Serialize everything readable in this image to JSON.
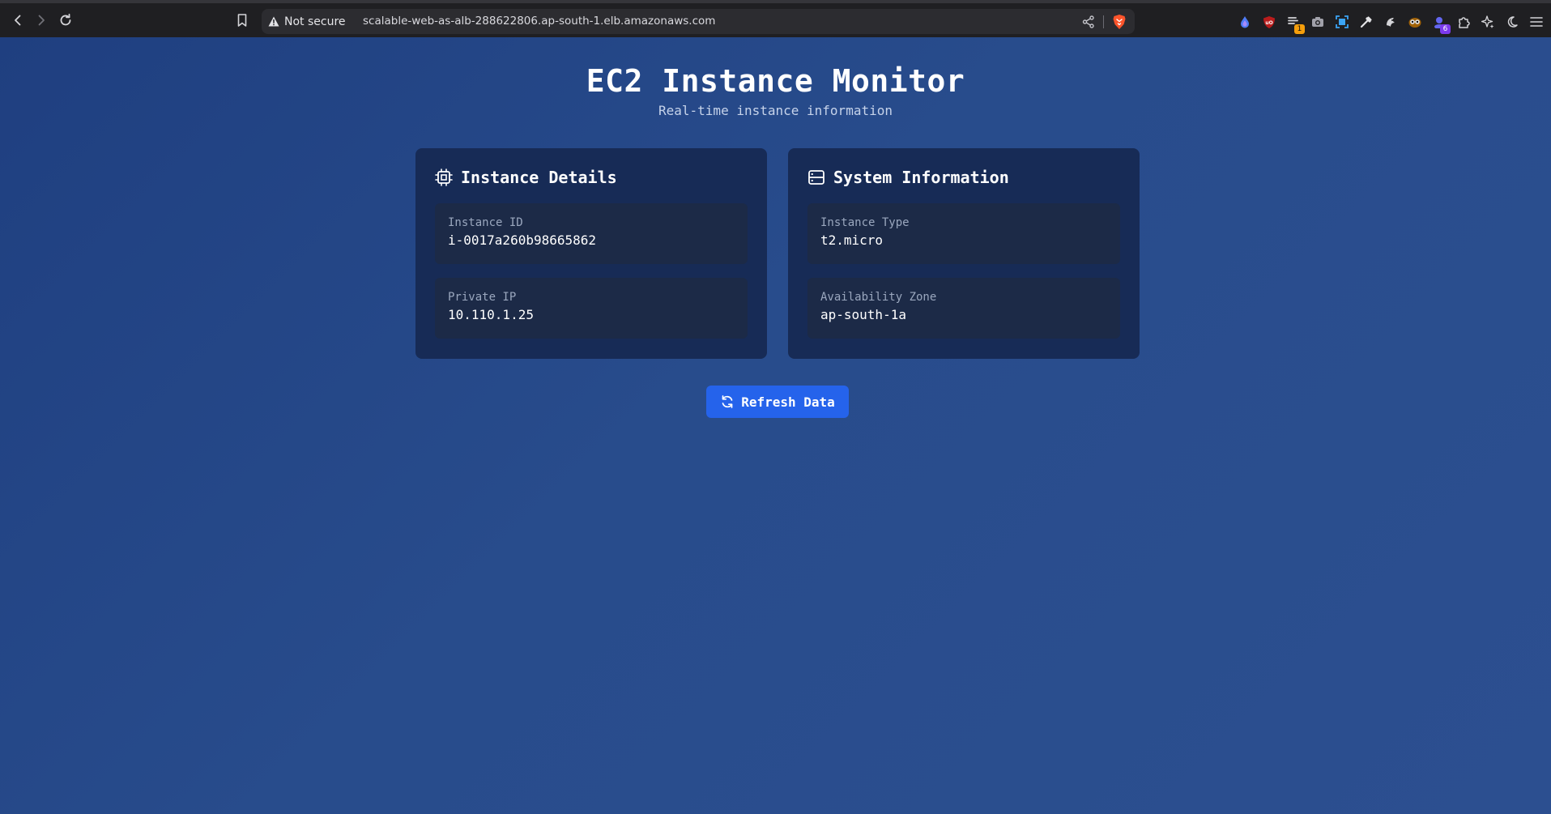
{
  "browser": {
    "security_label": "Not secure",
    "url": "scalable-web-as-alb-288622806.ap-south-1.elb.amazonaws.com",
    "extensions": [
      {
        "icon": "drop-extension-icon",
        "badge": ""
      },
      {
        "icon": "ublock-icon",
        "badge": ""
      },
      {
        "icon": "wrench-extension-icon",
        "badge": "1"
      },
      {
        "icon": "camera-icon",
        "badge": ""
      },
      {
        "icon": "screen-capture-icon",
        "badge": ""
      },
      {
        "icon": "eyedropper-icon",
        "badge": ""
      },
      {
        "icon": "raccoon-extension-icon",
        "badge": ""
      },
      {
        "icon": "owl-extension-icon",
        "badge": ""
      },
      {
        "icon": "user-extension-icon",
        "badge": "6"
      },
      {
        "icon": "puzzle-icon",
        "badge": ""
      },
      {
        "icon": "sparkle-icon",
        "badge": ""
      },
      {
        "icon": "moon-icon",
        "badge": ""
      },
      {
        "icon": "menu-icon",
        "badge": ""
      }
    ],
    "badge_colors": {
      "orange": "#f59e0b",
      "purple": "#7c3aed"
    }
  },
  "page": {
    "title": "EC2 Instance Monitor",
    "subtitle": "Real-time instance information"
  },
  "cards": {
    "instance": {
      "title": "Instance Details",
      "icon": "cpu-icon",
      "fields": [
        {
          "label": "Instance ID",
          "value": "i-0017a260b98665862"
        },
        {
          "label": "Private IP",
          "value": "10.110.1.25"
        }
      ]
    },
    "system": {
      "title": "System Information",
      "icon": "server-icon",
      "fields": [
        {
          "label": "Instance Type",
          "value": "t2.micro"
        },
        {
          "label": "Availability Zone",
          "value": "ap-south-1a"
        }
      ]
    }
  },
  "actions": {
    "refresh_label": "Refresh Data",
    "refresh_icon": "refresh-icon"
  },
  "colors": {
    "accent": "#2563eb",
    "card_bg": "#172b56",
    "field_bg": "#1c2a47"
  }
}
